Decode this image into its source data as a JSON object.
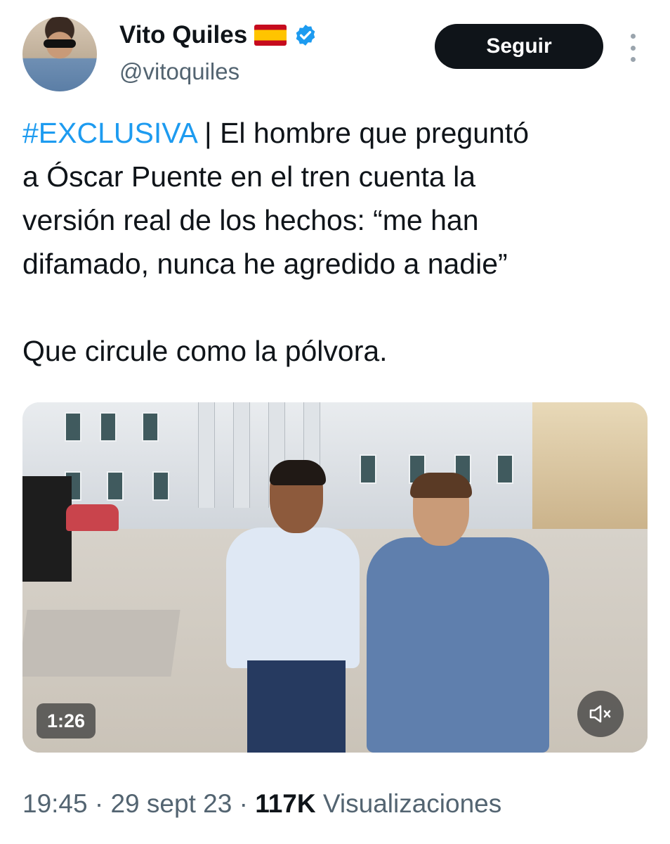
{
  "user": {
    "name": "Vito Quiles",
    "handle": "@vitoquiles",
    "flag_icon": "spain-flag-icon",
    "verified_icon": "verified-badge-icon"
  },
  "actions": {
    "follow_label": "Seguir",
    "more_icon": "more-vertical-icon"
  },
  "tweet": {
    "hashtag": "#EXCLUSIVA",
    "text_rest": " | El hombre que preguntó\na Óscar Puente en el tren cuenta la\nversión real de los hechos: “me han\ndifamado, nunca he agredido a nadie”\n\nQue circule como la pólvora."
  },
  "media": {
    "duration": "1:26",
    "mute_icon": "volume-muted-icon"
  },
  "meta": {
    "time": "19:45",
    "sep1": " · ",
    "date": "29 sept 23",
    "sep2": " · ",
    "views": "117K",
    "views_label": " Visualizaciones"
  },
  "colors": {
    "accent": "#1d9bf0",
    "text": "#0f1419",
    "muted": "#536471",
    "button": "#0f1419"
  }
}
